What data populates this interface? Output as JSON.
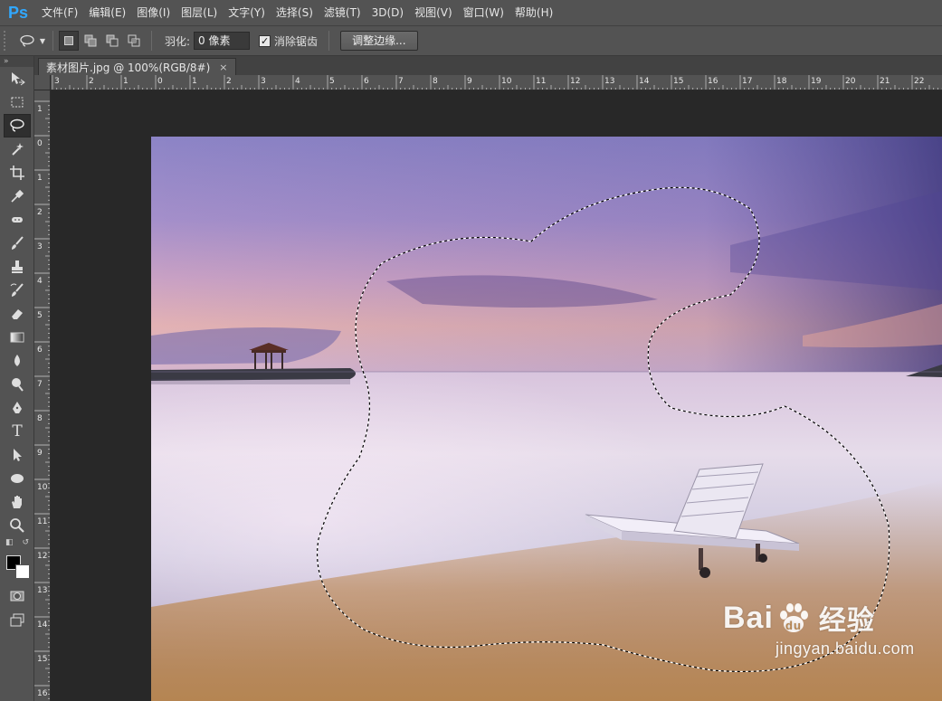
{
  "app": {
    "logo": "Ps",
    "accent": "#31a8ff"
  },
  "menu": [
    "文件(F)",
    "编辑(E)",
    "图像(I)",
    "图层(L)",
    "文字(Y)",
    "选择(S)",
    "滤镜(T)",
    "3D(D)",
    "视图(V)",
    "窗口(W)",
    "帮助(H)"
  ],
  "options": {
    "feather_label": "羽化:",
    "feather_value": "0 像素",
    "antialias_checked": true,
    "antialias_label": "消除锯齿",
    "refine_edge_label": "调整边缘..."
  },
  "toolbox": {
    "tools": [
      "move-icon",
      "marquee-icon",
      "lasso-icon",
      "magic-wand-icon",
      "crop-icon",
      "eyedropper-icon",
      "healing-brush-icon",
      "brush-icon",
      "clone-stamp-icon",
      "history-brush-icon",
      "eraser-icon",
      "gradient-icon",
      "blur-icon",
      "dodge-icon",
      "pen-icon",
      "type-icon",
      "path-selection-icon",
      "ellipse-shape-icon",
      "hand-icon",
      "zoom-icon"
    ],
    "active_tool": "lasso-icon",
    "foreground_color": "#000000",
    "background_color": "#ffffff"
  },
  "document": {
    "tab_title": "素材图片.jpg @ 100%(RGB/8#)",
    "close_glyph": "×"
  },
  "rulers": {
    "horizontal": [
      "3",
      "2",
      "1",
      "0",
      "1",
      "2",
      "3",
      "4",
      "5",
      "6",
      "7",
      "8",
      "9",
      "10",
      "11",
      "12",
      "13",
      "14",
      "15",
      "16",
      "17",
      "18",
      "19",
      "20",
      "21",
      "22"
    ],
    "vertical": [
      "1",
      "0",
      "1",
      "2",
      "3",
      "4",
      "5",
      "6",
      "7",
      "8",
      "9",
      "10",
      "11",
      "12",
      "13",
      "14",
      "15",
      "16"
    ]
  },
  "watermark": {
    "brand_left": "Bai",
    "brand_right": "du",
    "brand_cn": "经验",
    "url": "jingyan.baidu.com"
  }
}
